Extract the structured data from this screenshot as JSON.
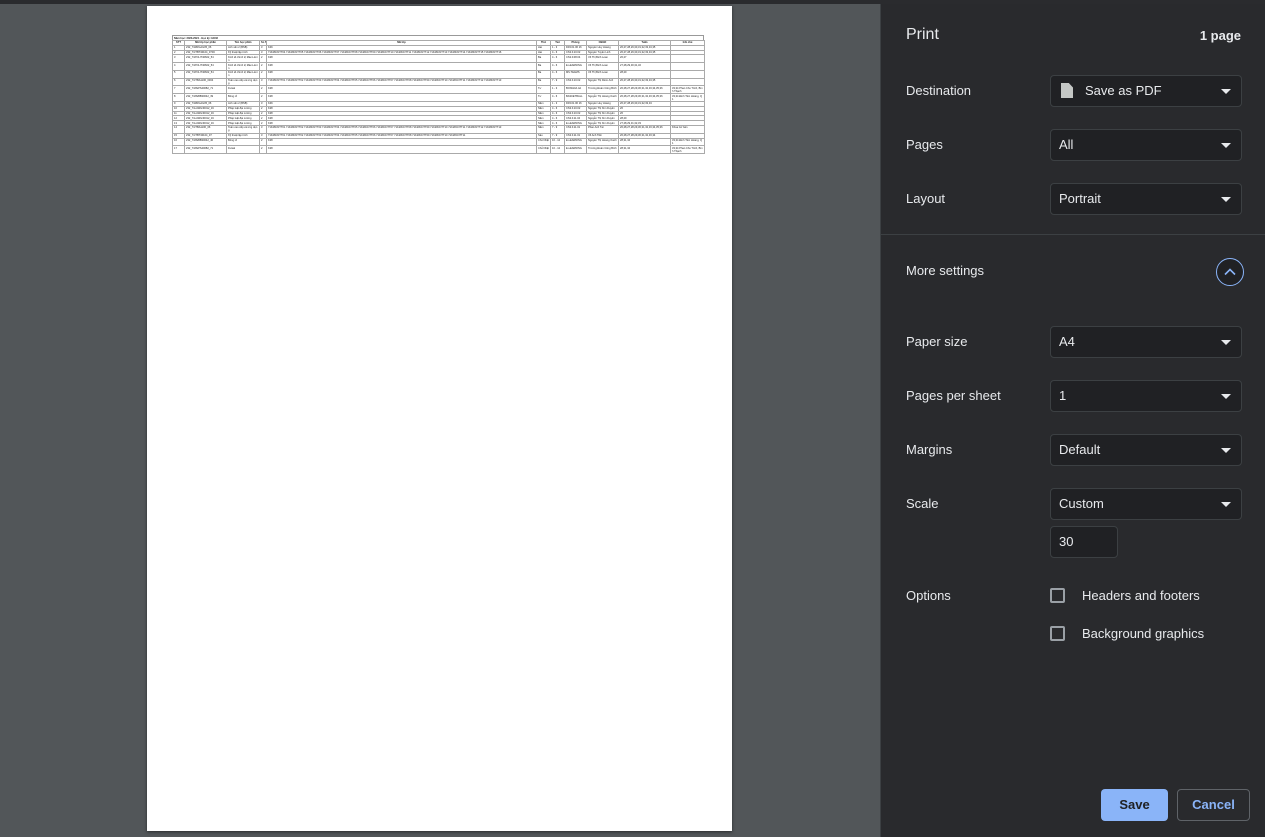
{
  "print": {
    "title": "Print",
    "page_count": "1 page",
    "destination": {
      "label": "Destination",
      "value": "Save as PDF",
      "icon": "pdf-file-icon"
    },
    "pages": {
      "label": "Pages",
      "value": "All"
    },
    "layout": {
      "label": "Layout",
      "value": "Portrait"
    },
    "more_settings": {
      "label": "More settings",
      "icon": "chevron-up-icon"
    },
    "paper_size": {
      "label": "Paper size",
      "value": "A4"
    },
    "pages_per_sheet": {
      "label": "Pages per sheet",
      "value": "1"
    },
    "margins": {
      "label": "Margins",
      "value": "Default"
    },
    "scale": {
      "label": "Scale",
      "value": "Custom",
      "custom_value": "30"
    },
    "options": {
      "label": "Options",
      "headers_footers": {
        "label": "Headers and footers",
        "checked": false
      },
      "background_graphics": {
        "label": "Background graphics",
        "checked": false
      }
    },
    "save_label": "Save",
    "cancel_label": "Cancel"
  },
  "document": {
    "header": "Năm học: 2023-2024 - Học kỳ: HK02",
    "columns": [
      "STT",
      "Mã lớp học phần",
      "Tên học phần",
      "Số TC",
      "Mã lớp",
      "Thứ",
      "Tiết",
      "Phòng",
      "CBGD",
      "Tuần",
      "Ghi chú"
    ],
    "rows": [
      [
        "1",
        "232_71RRGAG05_06",
        "Anh văn 2 (BSB)",
        "3",
        "K4K",
        "Hai",
        "1 - 3",
        "D03.01.06 16",
        "Nguyễn Huy Hoàng",
        "26,27,28,29,30,31,32,33,34,35",
        ""
      ],
      [
        "2",
        "232_71ITBT40104_0703",
        "Kỹ thuật lập trình",
        "3",
        "71K28CNTT04 71K28CNTT05 71K28CNTT06 71K28CNTT07 71K28CNTT08 71K28CNTT09 71K28CNTT10 71K28CNTT11 71K28CNTT12 71K28CNTT13 71K28CNTT14 71K28CNTT15 71K28CNTT16",
        "Hai",
        "4 - 6",
        "CS3.F.10.02",
        "Nguyễn Tuyên Linh",
        "26,27,28,29,30,31,32,33,34,35",
        ""
      ],
      [
        "3",
        "232_71POLIT40602_54",
        "Kinh tế chính trị Mác-Lênin",
        "2",
        "K28",
        "Ba",
        "4 - 6",
        "CS3.F.08.04",
        "Võ Thị Bích Loan",
        "26,27",
        ""
      ],
      [
        "4",
        "232_71POLIT40602_54",
        "Kinh tế chính trị Mác-Lênin",
        "2",
        "K28",
        "Ba",
        "4 - 6",
        "E-LEARNING",
        "Võ Thị Bích Loan",
        "27,28,29,30,31,32",
        ""
      ],
      [
        "5",
        "232_71POLIT40602_54",
        "Kinh tế chính trị Mác-Lênin",
        "2",
        "K28",
        "Ba",
        "4 - 6",
        "MS.TEAMS",
        "Võ Thị Bích Loan",
        "28,29",
        ""
      ],
      [
        "6",
        "232_71ITBA1106_0304",
        "Toán cao cấp và ứng dụng",
        "3",
        "71K28CNTT01 71K28CNTT02 71K28CNTT03 71K28CNTT04 71K28CNTT05 71K28CNTT06 71K28CNTT07 71K28CNTT08 71K28CNTT09 71K28CNTT10 71K28CNTT11 71K28CNTT12 71K28CNTT13",
        "Ba",
        "7 - 9",
        "CS3.F.10.02",
        "Nguyễn Thị Diễm Anh",
        "26,27,28,29,30,31,32,33,34,35",
        ""
      ],
      [
        "7",
        "232_71PEPS40082_71",
        "Futsal",
        "2",
        "K28",
        "Tư",
        "1 - 3",
        "BONGDA.4A",
        "Trương Đoàn Công Bình",
        "26,28,27,28,29,30,31,32,33,34,35,36",
        "33,34 Phan Chu Trinh, Bình Thạnh"
      ],
      [
        "8",
        "232_71PEBB30042_39",
        "Bóng rổ",
        "2",
        "K28",
        "Tư",
        "4 - 6",
        "BASKETBALL",
        "Nguyễn Thị Hoàng Oanh",
        "26,28,27,28,29,30,31,32,33,34,35,36",
        "33,34 Đinh Tiên Hoàng, Q1"
      ],
      [
        "9",
        "232_71RRGAG05_06",
        "Anh văn 2 (BSB)",
        "3",
        "K4K",
        "Năm",
        "1 - 3",
        "D03.01.06 16",
        "Nguyễn Huy Hoàng",
        "26,27,28,29,30,31,32,33,34",
        ""
      ],
      [
        "10",
        "232_71LAWG30012_19",
        "Pháp luật đại cương",
        "2",
        "K28",
        "Năm",
        "4 - 6",
        "CS3.F.10.02",
        "Nguyễn Thị Kim Duyên",
        "26",
        ""
      ],
      [
        "11",
        "232_71LAWG30012_19",
        "Pháp luật đại cương",
        "2",
        "K28",
        "Năm",
        "4 - 6",
        "CS3.F.10.02",
        "Nguyễn Thị Kim Duyên",
        "26",
        ""
      ],
      [
        "12",
        "232_71LAWG30012_19",
        "Pháp luật đại cương",
        "2",
        "K28",
        "Năm",
        "4 - 6",
        "CS3.F.11.04",
        "Nguyễn Thị Kim Duyên",
        "28,29",
        ""
      ],
      [
        "13",
        "232_71LAWG30012_19",
        "Pháp luật đại cương",
        "2",
        "K28",
        "Năm",
        "4 - 6",
        "E-LEARNING",
        "Nguyễn Thị Kim Duyên",
        "27,28,29,31,32,33",
        ""
      ],
      [
        "14",
        "232_71ITBA1106_06",
        "Toán cao cấp và ứng dụng",
        "3",
        "71K28CNTT01 71K28CNTT02 71K28CNTT03 71K28CNTT04 71K28CNTT05 71K28CNTT06 71K28CNTT07 71K28CNTT08 71K28CNTT09 71K28CNTT10 71K28CNTT11 71K28CNTT12 71K28CNTT13",
        "Năm",
        "7 - 9",
        "CS3.F.11.01",
        "Phan Anh Tài",
        "26,28,27,28,29,30,31,32,33,34,35,36",
        "Khoa Cơ bản"
      ],
      [
        "15",
        "232_71ITBT40104_07",
        "Kỹ thuật lập trình",
        "3",
        "71K28CNTT01 71K28CNTT02 71K28CNTT03 71K28CNTT04 71K28CNTT05 71K28CNTT06 71K28CNTT07 71K28CNTT08 71K28CNTT09 71K28CNTT10 71K28CNTT11",
        "Sáu",
        "7 - 9",
        "CS3.F.11.01",
        "Võ Anh Tiến",
        "26,28,27,28,29,30,31,32,33,34",
        ""
      ],
      [
        "16",
        "232_71PEBB30042_40",
        "Bóng rổ",
        "2",
        "K28",
        "Chủ Nhật",
        "10 - 12",
        "E-LEARNING",
        "Nguyễn Thị Hoàng Oanh",
        "28,31,34",
        "33,34 Đinh Tiên Hoàng, Q1"
      ],
      [
        "17",
        "232_71PEPS40082_71",
        "Futsal",
        "2",
        "K28",
        "Chủ Nhật",
        "10 - 12",
        "E-LEARNING",
        "Trương Đoàn Công Bình",
        "28,31,34",
        "33,34 Phan Chu Trinh, Bình Thạnh"
      ]
    ]
  }
}
